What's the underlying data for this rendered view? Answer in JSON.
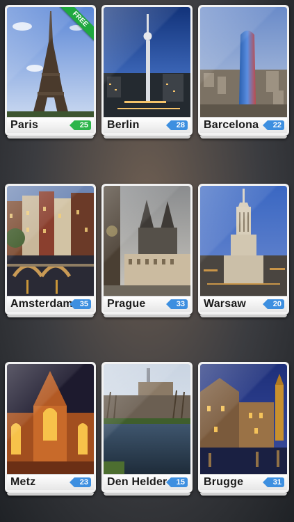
{
  "cities": [
    {
      "name": "Paris",
      "count": "25",
      "badge_color": "#2db54a",
      "free": "FREE"
    },
    {
      "name": "Berlin",
      "count": "28",
      "badge_color": "#3d8fe0"
    },
    {
      "name": "Barcelona",
      "count": "22",
      "badge_color": "#3d8fe0"
    },
    {
      "name": "Amsterdam",
      "count": "35",
      "badge_color": "#3d8fe0"
    },
    {
      "name": "Prague",
      "count": "33",
      "badge_color": "#3d8fe0"
    },
    {
      "name": "Warsaw",
      "count": "20",
      "badge_color": "#3d8fe0"
    },
    {
      "name": "Metz",
      "count": "23",
      "badge_color": "#3d8fe0"
    },
    {
      "name": "Den Helder",
      "count": "15",
      "badge_color": "#3d8fe0"
    },
    {
      "name": "Brugge",
      "count": "31",
      "badge_color": "#3d8fe0"
    }
  ]
}
